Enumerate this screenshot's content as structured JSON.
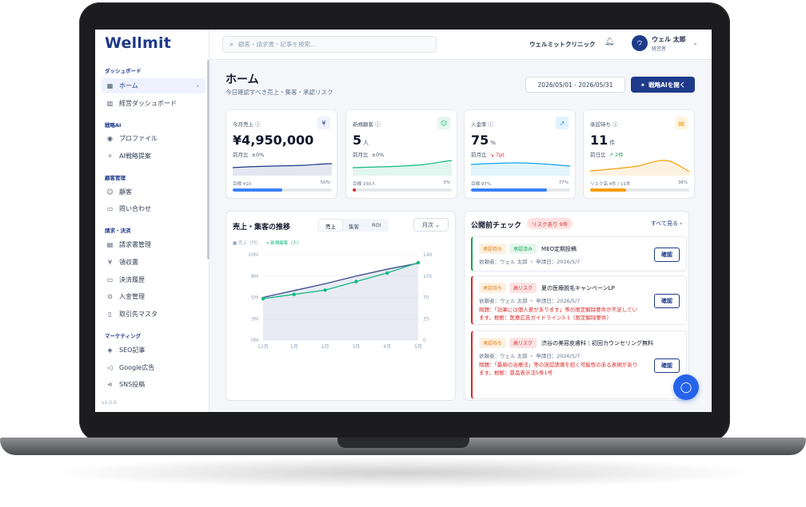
{
  "app": {
    "logo": "Wellmit",
    "version": "v1.0.0"
  },
  "sidebar": {
    "sections": {
      "dashboard": "ダッシュボード",
      "ai": "戦略AI",
      "customer": "顧客管理",
      "billing": "請求・決済",
      "marketing": "マーケティング"
    },
    "items": [
      {
        "label": "ホーム",
        "icon": "grid-icon"
      },
      {
        "label": "経営ダッシュボード",
        "icon": "bar-chart-icon"
      },
      {
        "label": "プロファイル",
        "icon": "profile-icon"
      },
      {
        "label": "AI戦略提案",
        "icon": "sparkle-icon"
      },
      {
        "label": "顧客",
        "icon": "users-icon"
      },
      {
        "label": "問い合わせ",
        "icon": "message-icon"
      },
      {
        "label": "請求書管理",
        "icon": "invoice-icon"
      },
      {
        "label": "領収書",
        "icon": "receipt-icon"
      },
      {
        "label": "決済履歴",
        "icon": "card-icon"
      },
      {
        "label": "入金管理",
        "icon": "deposit-icon"
      },
      {
        "label": "取引先マスタ",
        "icon": "book-icon"
      },
      {
        "label": "SEO記事",
        "icon": "seo-icon"
      },
      {
        "label": "Google広告",
        "icon": "megaphone-icon"
      },
      {
        "label": "SNS投稿",
        "icon": "share-icon"
      }
    ]
  },
  "topbar": {
    "search_placeholder": "顧客・請求書・記事を検索…",
    "clinic": "ウェルミットクリニック",
    "avatar_initial": "ウ",
    "user_name": "ウェル 太郎",
    "user_role": "経営者"
  },
  "header": {
    "title": "ホーム",
    "subtitle": "今日確認すべき売上・集客・承認リスク",
    "date_range": "2026/05/01 - 2026/05/31",
    "ai_button": "戦略AIを開く"
  },
  "kpis": [
    {
      "label": "今月売上 ⓘ",
      "icon": "yen-icon",
      "icon_glyph": "¥",
      "value": "¥4,950,000",
      "unit": "",
      "cmp_label": "前月比",
      "cmp": "±0%",
      "goal": "目標 ¥10",
      "pct": "50%",
      "progress": 0.5,
      "color": "#1e3a8a",
      "bar_color": "#3b82f6",
      "badge_bg": "#eef2ff"
    },
    {
      "label": "新規顧客 ⓘ",
      "icon": "users-icon",
      "icon_glyph": "☺",
      "value": "5",
      "unit": "人",
      "cmp_label": "前月比",
      "cmp": "±0%",
      "goal": "目標 150人",
      "pct": "3%",
      "progress": 0.03,
      "color": "#10b981",
      "bar_color": "#dc2626",
      "badge_bg": "#e6f7ee"
    },
    {
      "label": "入金率 ⓘ",
      "icon": "trend-up-icon",
      "icon_glyph": "↗",
      "value": "75",
      "unit": "%",
      "cmp_label": "前月比",
      "cmp": "↘ 7pt",
      "goal": "目標 97%",
      "pct": "77%",
      "progress": 0.77,
      "color": "#0ea5e9",
      "bar_color": "#3b82f6",
      "badge_bg": "#e0f2fe"
    },
    {
      "label": "承認待ち ⓘ",
      "icon": "clipboard-icon",
      "icon_glyph": "▤",
      "value": "11",
      "unit": "件",
      "cmp_label": "前日比",
      "cmp": "↗ 2件",
      "goal": "リスク高 4件 / 11件",
      "pct": "36%",
      "progress": 0.36,
      "color": "#f59e0b",
      "bar_color": "#f59e0b",
      "badge_bg": "#fff4e0"
    }
  ],
  "chart_card": {
    "title": "売上・集客の推移",
    "tabs": [
      "売上",
      "集客",
      "ROI"
    ],
    "period": "月次 ⌄",
    "legend_sales": "■ 売上（円）",
    "legend_customers": "━ 新規顧客（人）"
  },
  "chart_data": {
    "type": "line",
    "categories": [
      "12月",
      "1月",
      "2月",
      "3月",
      "4月",
      "5月"
    ],
    "series": [
      {
        "name": "売上（円）",
        "values": [
          5.0,
          5.8,
          6.6,
          7.5,
          8.3,
          9.0
        ],
        "axis": "left",
        "color": "#3b4a8a"
      },
      {
        "name": "新規顧客（人）",
        "values": [
          68,
          75,
          82,
          96,
          110,
          127
        ],
        "axis": "right",
        "color": "#10b981"
      }
    ],
    "y_left": {
      "ticks": [
        "10M",
        "8M",
        "5M",
        "3M",
        "0M"
      ],
      "lim": [
        0,
        10
      ]
    },
    "y_right": {
      "ticks": [
        "140",
        "105",
        "70",
        "35",
        "0"
      ],
      "lim": [
        0,
        140
      ]
    },
    "grid": true,
    "legend": "top-left"
  },
  "review": {
    "title": "公開前チェック",
    "risk_badge": "リスクあり 9件",
    "view_all": "すべて見る ›",
    "items": [
      {
        "tags": [
          [
            "承認待ち",
            "wait"
          ],
          [
            "承認済み",
            "done"
          ]
        ],
        "title": "MEO定期投稿",
        "meta": "依頼者：ウェル 太郎 ・ 申請日：2026/5/7",
        "warn": "",
        "accent": "#16a34a",
        "button": "確認"
      },
      {
        "tags": [
          [
            "承認待ち",
            "wait"
          ],
          [
            "高リスク",
            "high"
          ]
        ],
        "title": "夏の医療脱毛キャンペーンLP",
        "meta": "依頼者：ウェル 太郎 ・ 申請日：2026/5/7",
        "warn": "問題：「効果には個人差があります」等の限定解除要件が不足しています。根拠：医療広告ガイドライン3-1（限定解除要件）",
        "accent": "#dc2626",
        "button": "確認"
      },
      {
        "tags": [
          [
            "承認待ち",
            "wait"
          ],
          [
            "高リスク",
            "high"
          ]
        ],
        "title": "渋谷の美容皮膚科｜初回カウンセリング無料",
        "meta": "依頼者：ウェル 太郎 ・ 申請日：2026/5/7",
        "warn": "問題：「最新の治療法」等の誤認誘導を招く可能性のある表現があります。根拠：景品表示法5条1号",
        "accent": "#dc2626",
        "button": "確認"
      }
    ]
  }
}
